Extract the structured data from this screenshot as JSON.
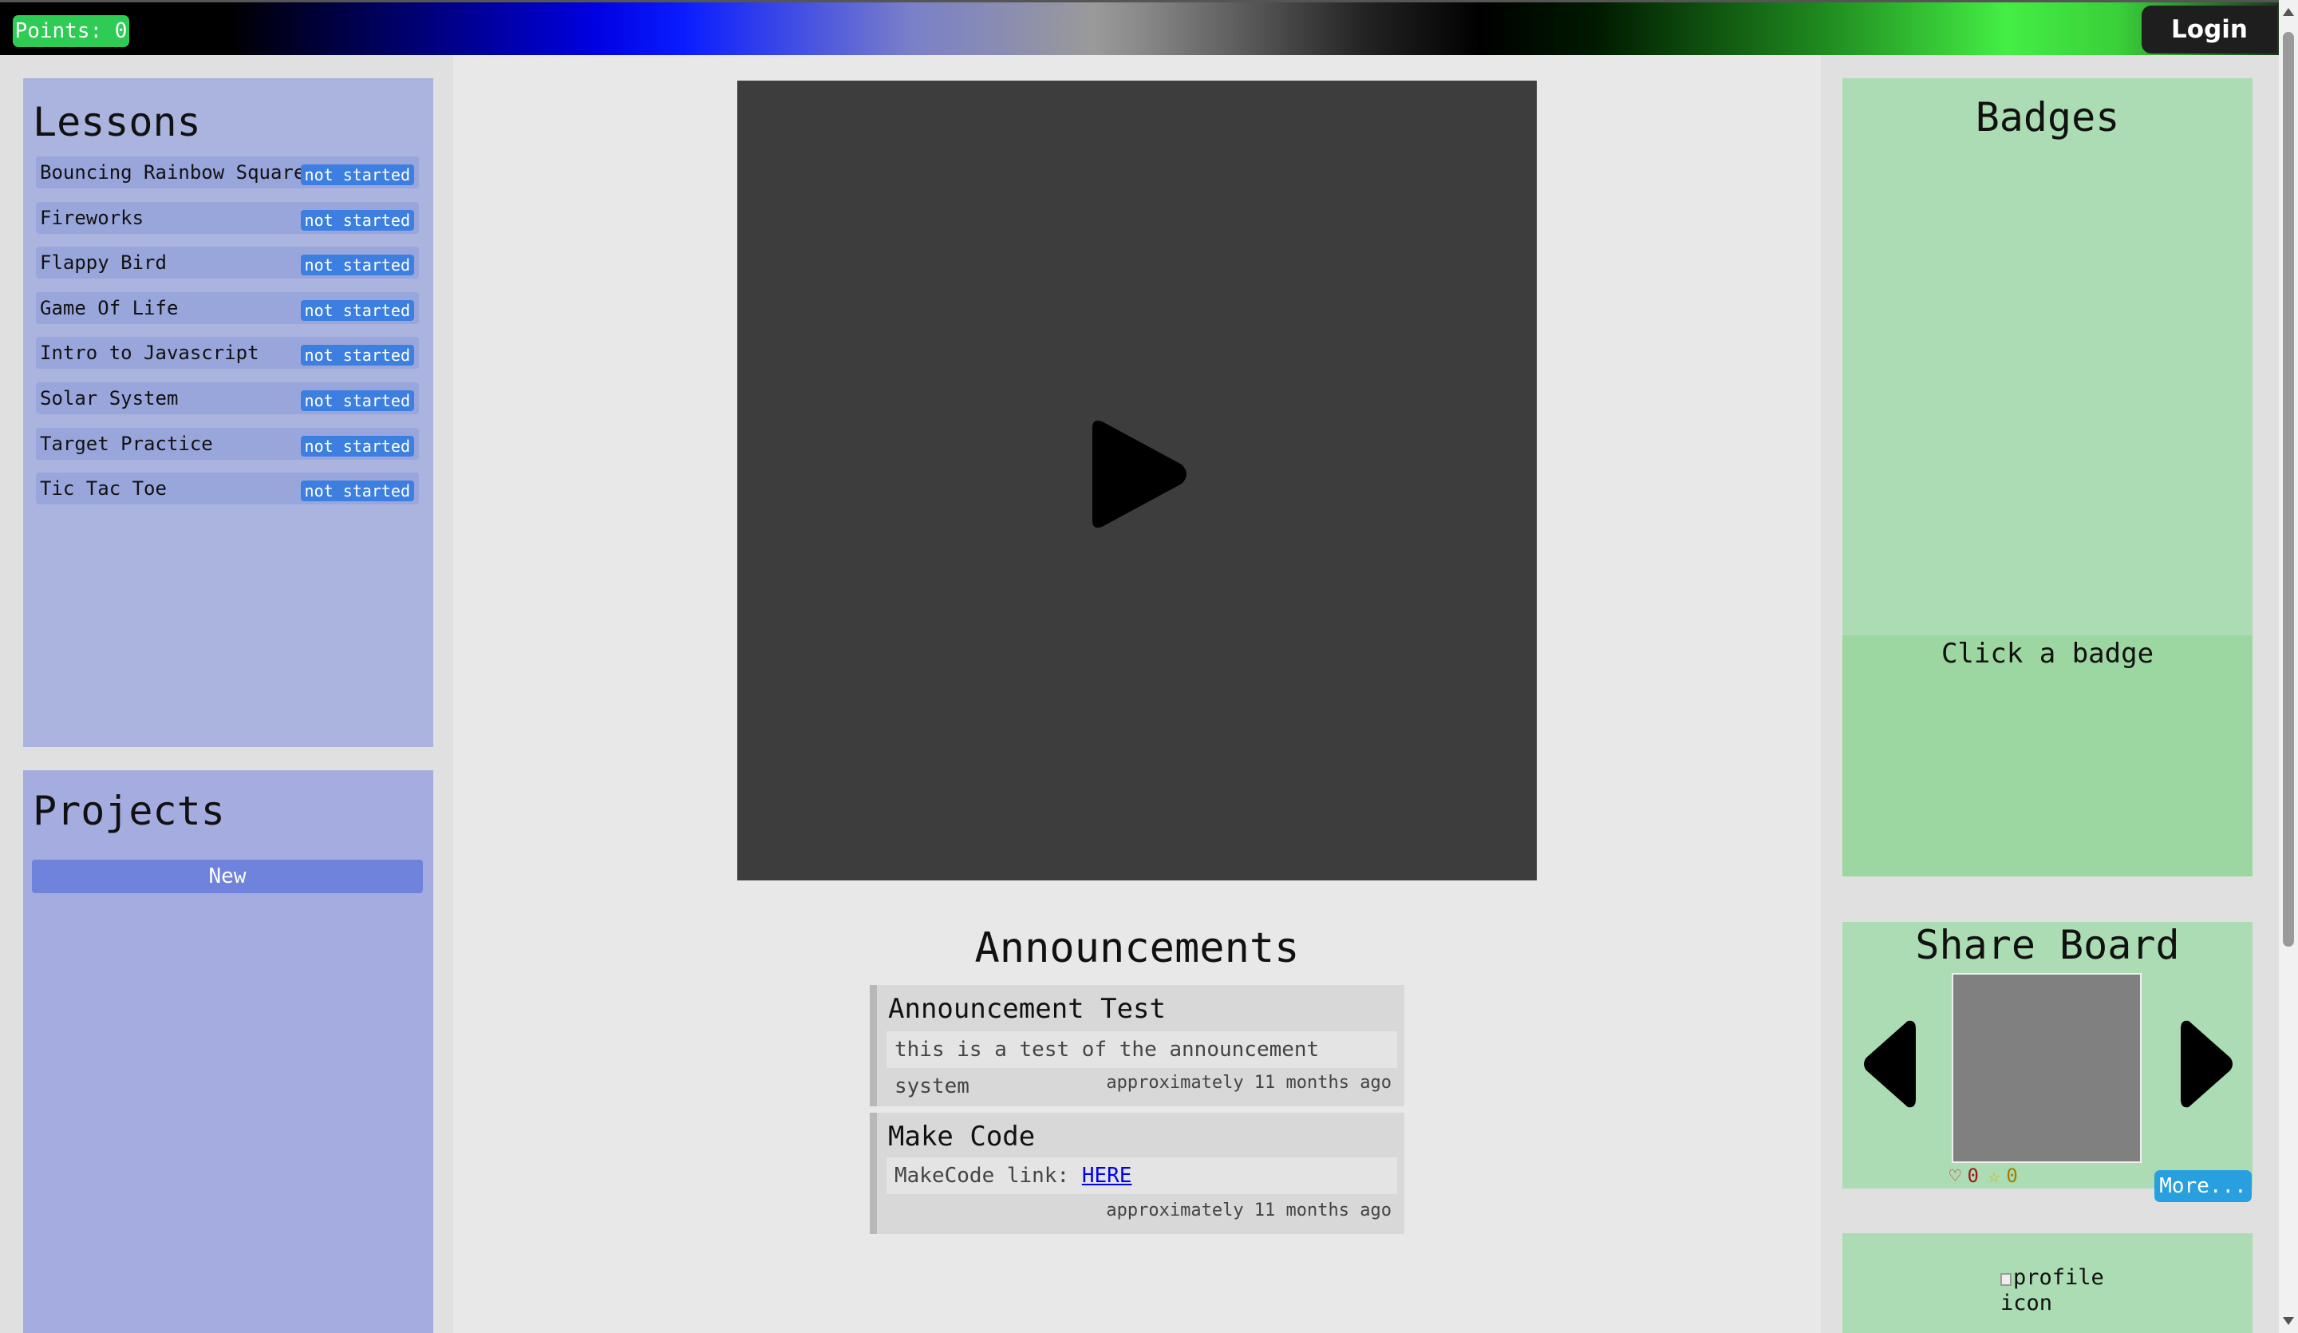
{
  "header": {
    "points_label": "Points: 0",
    "login_label": "Login"
  },
  "lessons": {
    "title": "Lessons",
    "items": [
      {
        "name": "Bouncing Rainbow Squares",
        "status": "not started"
      },
      {
        "name": "Fireworks",
        "status": "not started"
      },
      {
        "name": "Flappy Bird",
        "status": "not started"
      },
      {
        "name": "Game Of Life",
        "status": "not started"
      },
      {
        "name": "Intro to Javascript",
        "status": "not started"
      },
      {
        "name": "Solar System",
        "status": "not started"
      },
      {
        "name": "Target Practice",
        "status": "not started"
      },
      {
        "name": "Tic Tac Toe",
        "status": "not started"
      }
    ]
  },
  "projects": {
    "title": "Projects",
    "new_label": "New"
  },
  "video": {
    "play_icon": "play-icon"
  },
  "announcements": {
    "title": "Announcements",
    "items": [
      {
        "title": "Announcement Test",
        "body": "this is a test of the announcement system",
        "time": "approximately 11 months ago"
      },
      {
        "title": "Make Code",
        "body_prefix": "MakeCode link: ",
        "link_text": "HERE",
        "time": "approximately 11 months ago"
      }
    ]
  },
  "badges": {
    "title": "Badges",
    "hint": "Click a badge"
  },
  "share_board": {
    "title": "Share Board",
    "likes": "0",
    "stars": "0",
    "more_label": "More..."
  },
  "profile": {
    "alt_text": "profile\nicon"
  },
  "colors": {
    "points_badge": "#2ecc55",
    "lessons_panel": "#aab4df",
    "status_badge": "#3d7fe0",
    "badges_panel": "#acdcb3",
    "more_button": "#28a0e0"
  }
}
